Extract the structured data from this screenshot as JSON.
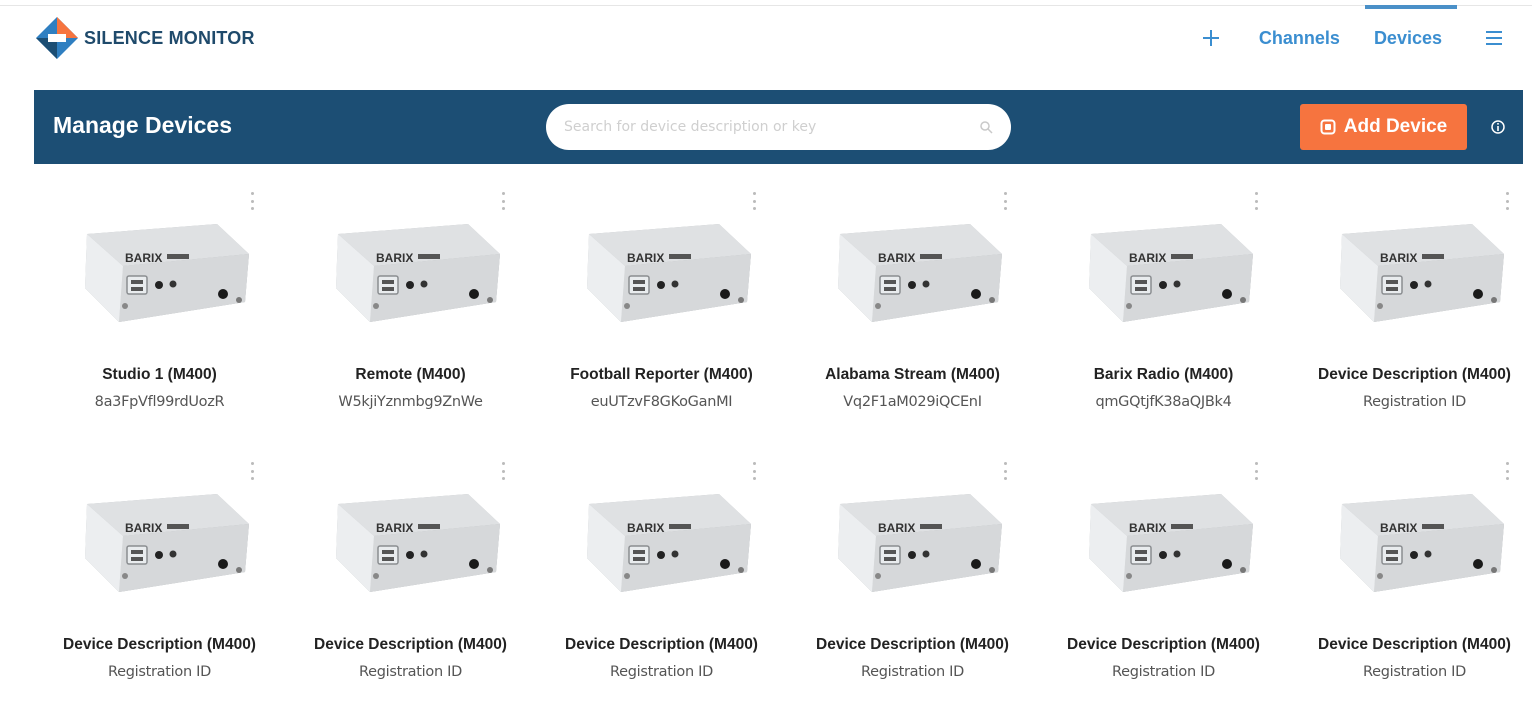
{
  "app": {
    "brand_name": "SILENCE MONITOR"
  },
  "topnav": {
    "plus_icon": "plus-icon",
    "channels_label": "Channels",
    "devices_label": "Devices",
    "menu_icon": "hamburger-menu-icon"
  },
  "toolbar": {
    "title": "Manage Devices",
    "search_placeholder": "Search for device description or key",
    "add_device_label": "Add Device"
  },
  "devices": [
    {
      "name": "Studio 1 (M400)",
      "registration": "8a3FpVfl99rdUozR"
    },
    {
      "name": "Remote  (M400)",
      "registration": "W5kjiYznmbg9ZnWe"
    },
    {
      "name": "Football Reporter (M400)",
      "registration": "euUTzvF8GKoGanMI"
    },
    {
      "name": "Alabama Stream (M400)",
      "registration": "Vq2F1aM029iQCEnI"
    },
    {
      "name": "Barix Radio (M400)",
      "registration": "qmGQtjfK38aQJBk4"
    },
    {
      "name": "Device Description (M400)",
      "registration": "Registration ID"
    },
    {
      "name": "Device Description (M400)",
      "registration": "Registration ID"
    },
    {
      "name": "Device Description (M400)",
      "registration": "Registration ID"
    },
    {
      "name": "Device Description (M400)",
      "registration": "Registration ID"
    },
    {
      "name": "Device Description (M400)",
      "registration": "Registration ID"
    },
    {
      "name": "Device Description (M400)",
      "registration": "Registration ID"
    },
    {
      "name": "Device Description (M400)",
      "registration": "Registration ID"
    }
  ],
  "device_brand_label": "BARIX",
  "colors": {
    "header_bar": "#1c4e74",
    "accent": "#3b8ed0",
    "add_button": "#f6743f"
  }
}
